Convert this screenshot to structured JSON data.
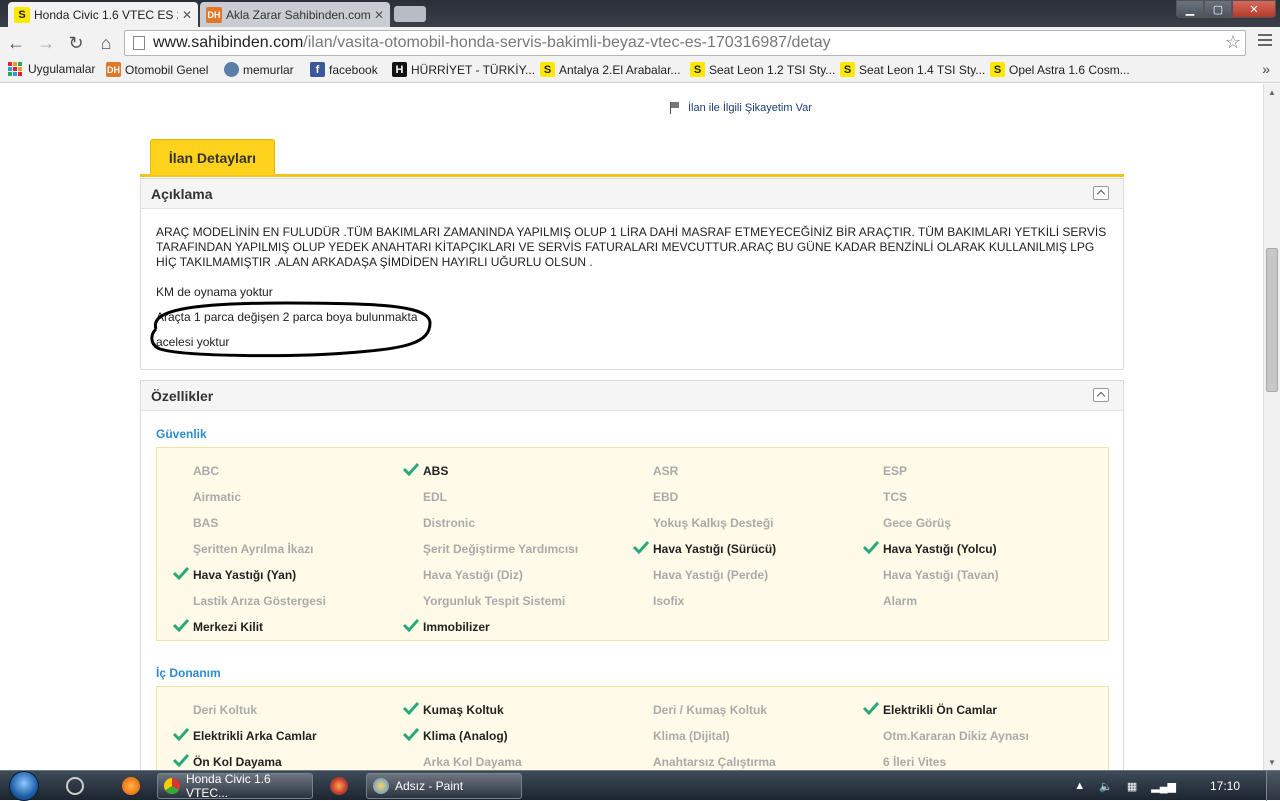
{
  "browser": {
    "tabs": [
      {
        "title": "Honda Civic 1.6 VTEC ES 2",
        "favicon": "S",
        "active": true
      },
      {
        "title": "Akla Zarar Sahibinden.com",
        "favicon": "DH",
        "active": false
      }
    ],
    "close_glyph": "✕",
    "address": {
      "host": "www.sahibinden.com",
      "path": "/ilan/vasita-otomobil-honda-servis-bakimli-beyaz-vtec-es-170316987/detay"
    },
    "bookmarks": [
      {
        "label": "Uygulamalar",
        "favicon": "apps-grid"
      },
      {
        "label": "Otomobil Genel",
        "favicon": "DH"
      },
      {
        "label": "memurlar",
        "favicon": "memurlar"
      },
      {
        "label": "facebook",
        "favicon": "f"
      },
      {
        "label": "HÜRRİYET - TÜRKİY...",
        "favicon": "H"
      },
      {
        "label": "Antalya 2.El Arabalar...",
        "favicon": "S"
      },
      {
        "label": "Seat Leon 1.2 TSI Sty...",
        "favicon": "S"
      },
      {
        "label": "Seat Leon 1.4 TSI Sty...",
        "favicon": "S"
      },
      {
        "label": "Opel Astra 1.6 Cosm...",
        "favicon": "S"
      }
    ],
    "more_glyph": "»"
  },
  "page": {
    "complaint_link": "İlan ile İlgili Şikayetim Var",
    "detail_tab": "İlan Detayları",
    "description": {
      "title": "Açıklama",
      "paragraph": "ARAÇ MODELİNİN EN FULUDÜR .TÜM BAKIMLARI ZAMANINDA YAPILMIŞ OLUP 1 LİRA DAHİ MASRAF ETMEYECEĞİNİZ BİR ARAÇTIR. TÜM BAKIMLARI YETKİLİ SERVİS TARAFINDAN YAPILMIŞ OLUP YEDEK ANAHTARI KİTAPÇIKLARI VE SERVİS FATURALARI MEVCUTTUR.ARAÇ BU GÜNE KADAR BENZİNLİ OLARAK KULLANILMIŞ LPG HİÇ TAKILMAMIŞTIR .ALAN ARKADAŞA ŞİMDİDEN HAYIRLI UĞURLU OLSUN .",
      "line1": "KM de oynama yoktur",
      "line2": "Araçta 1 parca değişen 2 parca boya bulunmakta",
      "line3": "acelesi yoktur"
    },
    "features": {
      "title": "Özellikler",
      "guvenlik_title": "Güvenlik",
      "guvenlik": [
        {
          "label": "ABC",
          "on": false
        },
        {
          "label": "ABS",
          "on": true
        },
        {
          "label": "ASR",
          "on": false
        },
        {
          "label": "ESP",
          "on": false
        },
        {
          "label": "Airmatic",
          "on": false
        },
        {
          "label": "EDL",
          "on": false
        },
        {
          "label": "EBD",
          "on": false
        },
        {
          "label": "TCS",
          "on": false
        },
        {
          "label": "BAS",
          "on": false
        },
        {
          "label": "Distronic",
          "on": false
        },
        {
          "label": "Yokuş Kalkış Desteği",
          "on": false
        },
        {
          "label": "Gece Görüş",
          "on": false
        },
        {
          "label": "Şeritten Ayrılma İkazı",
          "on": false
        },
        {
          "label": "Şerit Değiştirme Yardımcısı",
          "on": false
        },
        {
          "label": "Hava Yastığı (Sürücü)",
          "on": true
        },
        {
          "label": "Hava Yastığı (Yolcu)",
          "on": true
        },
        {
          "label": "Hava Yastığı (Yan)",
          "on": true
        },
        {
          "label": "Hava Yastığı (Diz)",
          "on": false
        },
        {
          "label": "Hava Yastığı (Perde)",
          "on": false
        },
        {
          "label": "Hava Yastığı (Tavan)",
          "on": false
        },
        {
          "label": "Lastik Arıza Göstergesi",
          "on": false
        },
        {
          "label": "Yorgunluk Tespit Sistemi",
          "on": false
        },
        {
          "label": "Isofix",
          "on": false
        },
        {
          "label": "Alarm",
          "on": false
        },
        {
          "label": "Merkezi Kilit",
          "on": true
        },
        {
          "label": "Immobilizer",
          "on": true
        }
      ],
      "ic_title": "İç Donanım",
      "ic": [
        {
          "label": "Deri Koltuk",
          "on": false
        },
        {
          "label": "Kumaş Koltuk",
          "on": true
        },
        {
          "label": "Deri / Kumaş Koltuk",
          "on": false
        },
        {
          "label": "Elektrikli Ön Camlar",
          "on": true
        },
        {
          "label": "Elektrikli Arka Camlar",
          "on": true
        },
        {
          "label": "Klima (Analog)",
          "on": true
        },
        {
          "label": "Klima (Dijital)",
          "on": false
        },
        {
          "label": "Otm.Kararan Dikiz Aynası",
          "on": false
        },
        {
          "label": "Ön Kol Dayama",
          "on": true
        },
        {
          "label": "Arka Kol Dayama",
          "on": false
        },
        {
          "label": "Anahtarsız Çalıştırma",
          "on": false
        },
        {
          "label": "6 İleri Vites",
          "on": false
        }
      ]
    }
  },
  "taskbar": {
    "tasks": [
      {
        "label": "Honda Civic 1.6 VTEC..."
      },
      {
        "label": "Adsız - Paint"
      }
    ],
    "clock": "17:10"
  },
  "colors": {
    "accent_yellow": "#ffd21e",
    "link_blue": "#2d8bd1",
    "check_green": "#2aa87a"
  }
}
